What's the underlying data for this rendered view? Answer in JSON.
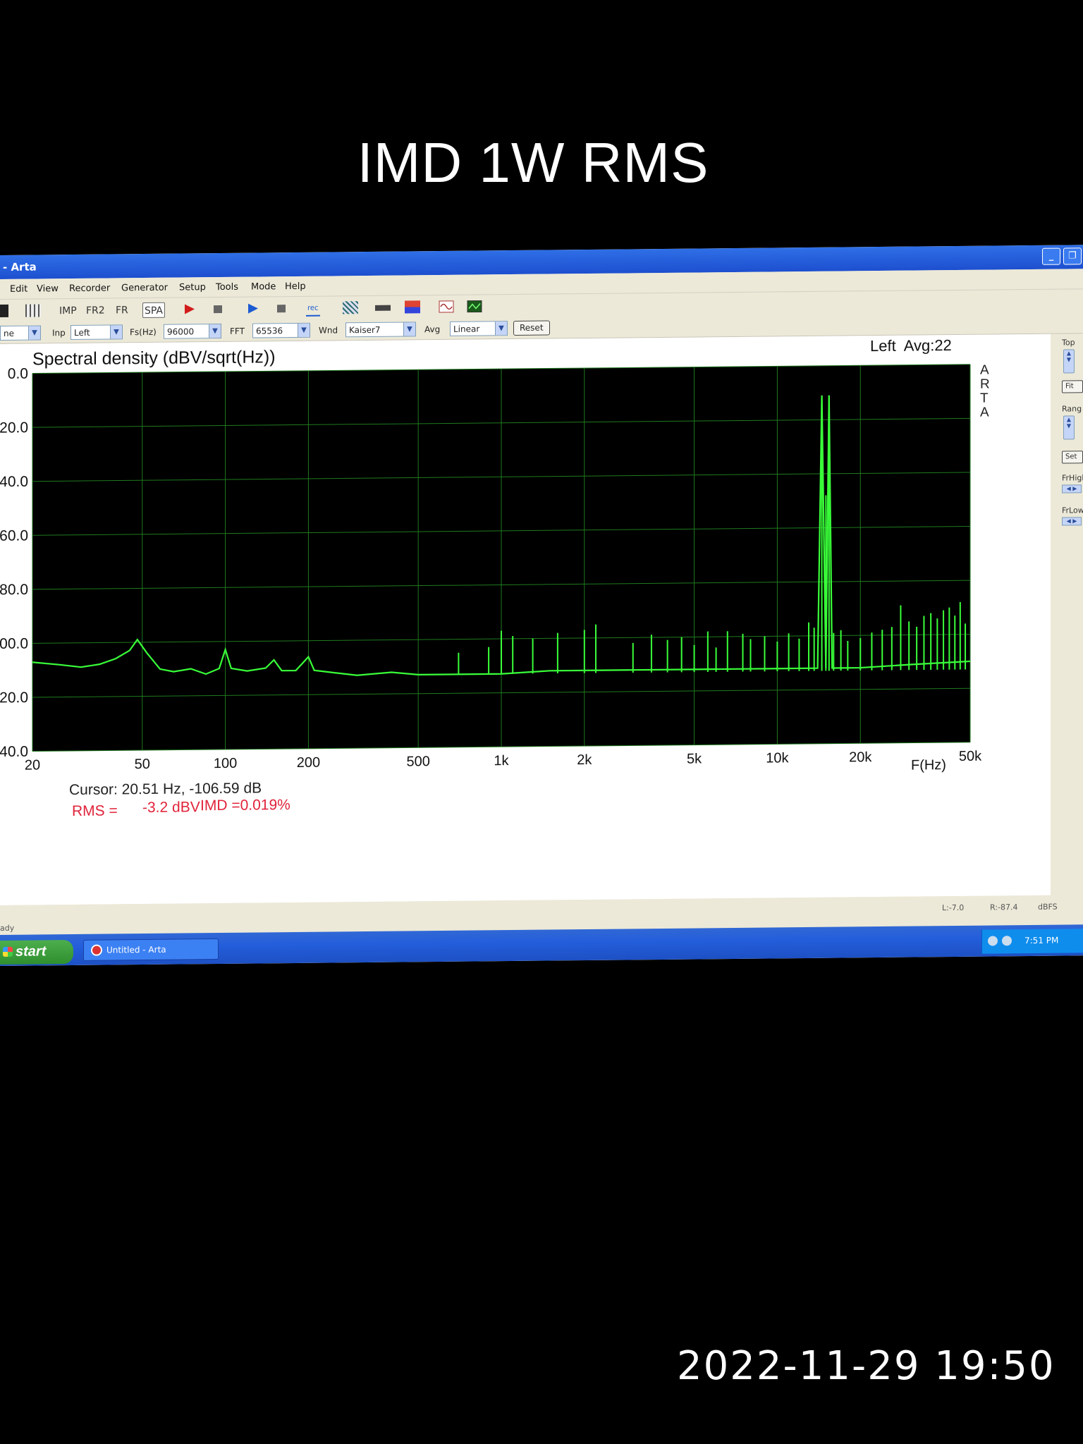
{
  "photo": {
    "caption": "IMD 1W RMS",
    "timestamp": "2022-11-29 19:50"
  },
  "window": {
    "title": "- Arta"
  },
  "menu": [
    "Edit",
    "View",
    "Recorder",
    "Generator",
    "Setup",
    "Tools",
    "Mode",
    "Help"
  ],
  "toolbar": {
    "imp": "IMP",
    "fr2": "FR2",
    "frx": "FR",
    "spa": "SPA",
    "rec": "rec"
  },
  "controls": {
    "mode_value": "ne",
    "inp_label": "Inp",
    "inp_value": "Left",
    "fs_label": "Fs(Hz)",
    "fs_value": "96000",
    "fft_label": "FFT",
    "fft_value": "65536",
    "wnd_label": "Wnd",
    "wnd_value": "Kaiser7",
    "avg_label": "Avg",
    "avg_value": "Linear",
    "reset_label": "Reset"
  },
  "side_panel": {
    "top_label": "Top",
    "fit_label": "Fit",
    "range_label": "Rang",
    "set_label": "Set",
    "frhigh_label": "FrHigh",
    "frlow_label": "FrLow"
  },
  "chart_data": {
    "type": "line",
    "title": "Spectral density (dBV/sqrt(Hz))",
    "channel_info": "Left  Avg:22",
    "watermark": "ARTA",
    "xlabel": "F(Hz)",
    "x_scale": "log",
    "xlim": [
      20,
      50000
    ],
    "ylim": [
      -140,
      0
    ],
    "x_ticks": [
      20,
      50,
      100,
      200,
      500,
      1000,
      2000,
      5000,
      10000,
      20000,
      50000
    ],
    "x_tick_labels": [
      "20",
      "50",
      "100",
      "200",
      "500",
      "1k",
      "2k",
      "5k",
      "10k",
      "20k",
      "50k"
    ],
    "y_ticks": [
      0,
      -20,
      -40,
      -60,
      -80,
      -100,
      -120,
      -140
    ],
    "y_tick_labels": [
      "0.0",
      "20.0",
      "40.0",
      "60.0",
      "-80.0",
      "-100.0",
      "-120.0",
      "-140.0"
    ],
    "grid": true,
    "series": [
      {
        "color": "#39ff39",
        "points": [
          [
            20,
            -107
          ],
          [
            25,
            -108
          ],
          [
            30,
            -109
          ],
          [
            35,
            -108
          ],
          [
            40,
            -106
          ],
          [
            45,
            -103
          ],
          [
            48,
            -99
          ],
          [
            52,
            -104
          ],
          [
            58,
            -110
          ],
          [
            65,
            -111
          ],
          [
            75,
            -110
          ],
          [
            85,
            -112
          ],
          [
            95,
            -110
          ],
          [
            100,
            -103
          ],
          [
            105,
            -110
          ],
          [
            120,
            -111
          ],
          [
            140,
            -110
          ],
          [
            150,
            -107
          ],
          [
            160,
            -111
          ],
          [
            180,
            -111
          ],
          [
            200,
            -106
          ],
          [
            210,
            -111
          ],
          [
            250,
            -112
          ],
          [
            300,
            -113
          ],
          [
            400,
            -112
          ],
          [
            500,
            -113
          ],
          [
            700,
            -113
          ],
          [
            1000,
            -113
          ],
          [
            1500,
            -112
          ],
          [
            2000,
            -112
          ],
          [
            3000,
            -112
          ],
          [
            5000,
            -112
          ],
          [
            7000,
            -112
          ],
          [
            10000,
            -112
          ],
          [
            13000,
            -112
          ],
          [
            14000,
            -112
          ],
          [
            14500,
            -11
          ],
          [
            15000,
            -112
          ],
          [
            15400,
            -11
          ],
          [
            15800,
            -112
          ],
          [
            20000,
            -112
          ],
          [
            30000,
            -111
          ],
          [
            50000,
            -110
          ]
        ],
        "spikes": [
          [
            700,
            -105
          ],
          [
            900,
            -103
          ],
          [
            1000,
            -97
          ],
          [
            1100,
            -99
          ],
          [
            1300,
            -100
          ],
          [
            1600,
            -98
          ],
          [
            2000,
            -97
          ],
          [
            2200,
            -95
          ],
          [
            3000,
            -102
          ],
          [
            3500,
            -99
          ],
          [
            4000,
            -101
          ],
          [
            4500,
            -100
          ],
          [
            5000,
            -103
          ],
          [
            5600,
            -98
          ],
          [
            6000,
            -104
          ],
          [
            6600,
            -98
          ],
          [
            7500,
            -99
          ],
          [
            8000,
            -101
          ],
          [
            9000,
            -100
          ],
          [
            10000,
            -102
          ],
          [
            11000,
            -99
          ],
          [
            12000,
            -101
          ],
          [
            13000,
            -95
          ],
          [
            13600,
            -97
          ],
          [
            14500,
            -11
          ],
          [
            15000,
            -48
          ],
          [
            15400,
            -11
          ],
          [
            16000,
            -99
          ],
          [
            17000,
            -98
          ],
          [
            18000,
            -102
          ],
          [
            20000,
            -101
          ],
          [
            22000,
            -99
          ],
          [
            24000,
            -98
          ],
          [
            26000,
            -97
          ],
          [
            28000,
            -89
          ],
          [
            30000,
            -95
          ],
          [
            32000,
            -97
          ],
          [
            34000,
            -93
          ],
          [
            36000,
            -92
          ],
          [
            38000,
            -94
          ],
          [
            40000,
            -91
          ],
          [
            42000,
            -90
          ],
          [
            44000,
            -93
          ],
          [
            46000,
            -88
          ],
          [
            48000,
            -96
          ]
        ]
      }
    ]
  },
  "readouts": {
    "cursor": "Cursor: 20.51 Hz, -106.59 dB",
    "rms_label": "RMS =",
    "rms_value": "-3.2 dBV",
    "imd": "IMD =0.019%"
  },
  "status": {
    "ready": "ady",
    "l": "L:-7.0",
    "r": "R:-87.4",
    "unit": "dBFS"
  },
  "taskbar": {
    "start": "start",
    "task": "Untitled - Arta",
    "clock": "7:51 PM"
  },
  "colors": {
    "plot_bg": "#000000",
    "grid": "#1f7a1f",
    "trace": "#39ff39",
    "readout_red": "#e0233a"
  }
}
